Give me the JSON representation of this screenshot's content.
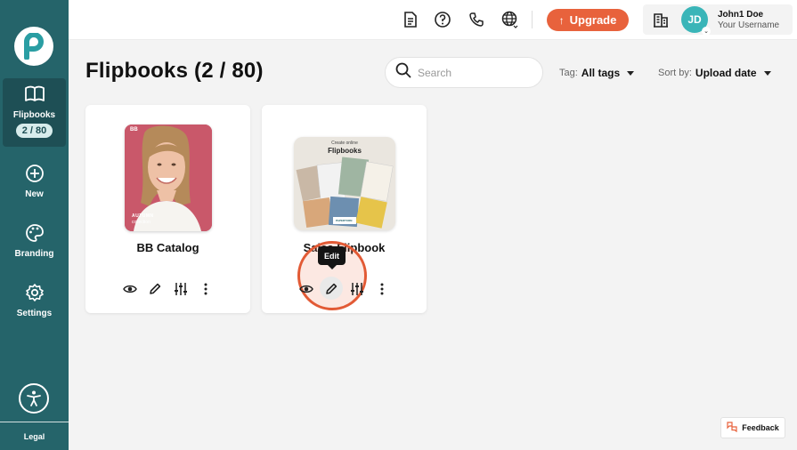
{
  "sidebar": {
    "logo_icon": "paperturn-logo",
    "items": [
      {
        "label": "Flipbooks",
        "icon": "book-icon",
        "badge": "2 / 80",
        "active": true
      },
      {
        "label": "New",
        "icon": "plus-circle-icon"
      },
      {
        "label": "Branding",
        "icon": "palette-icon"
      },
      {
        "label": "Settings",
        "icon": "gear-icon"
      }
    ],
    "accessibility_icon": "accessibility-icon",
    "legal_label": "Legal"
  },
  "header": {
    "icons": [
      "document-icon",
      "help-icon",
      "phone-icon",
      "globe-icon"
    ],
    "upgrade_label": "Upgrade",
    "building_icon": "building-icon",
    "user": {
      "initials": "JD",
      "name": "John1 Doe",
      "subtitle": "Your Username"
    }
  },
  "main": {
    "title": "Flipbooks (2 / 80)",
    "search": {
      "placeholder": "Search",
      "value": ""
    },
    "tag_filter": {
      "label": "Tag:",
      "value": "All tags"
    },
    "sort": {
      "label": "Sort by:",
      "value": "Upload date"
    },
    "cards": [
      {
        "name": "BB Catalog",
        "thumbnail": {
          "top_text": "BB",
          "bottom_line1": "AUTUMN",
          "bottom_line2": "collection"
        }
      },
      {
        "name": "Sales Flipbook",
        "thumbnail": {
          "line1": "Create online",
          "line2": "Flipbooks",
          "brand": "PAPERTURN"
        }
      }
    ],
    "card_actions": [
      "view-icon",
      "edit-icon",
      "settings-sliders-icon",
      "more-icon"
    ],
    "tooltip": "Edit"
  },
  "feedback_label": "Feedback",
  "colors": {
    "sidebar": "#25646a",
    "accent": "#e8623c",
    "avatar": "#3ab5b8"
  }
}
